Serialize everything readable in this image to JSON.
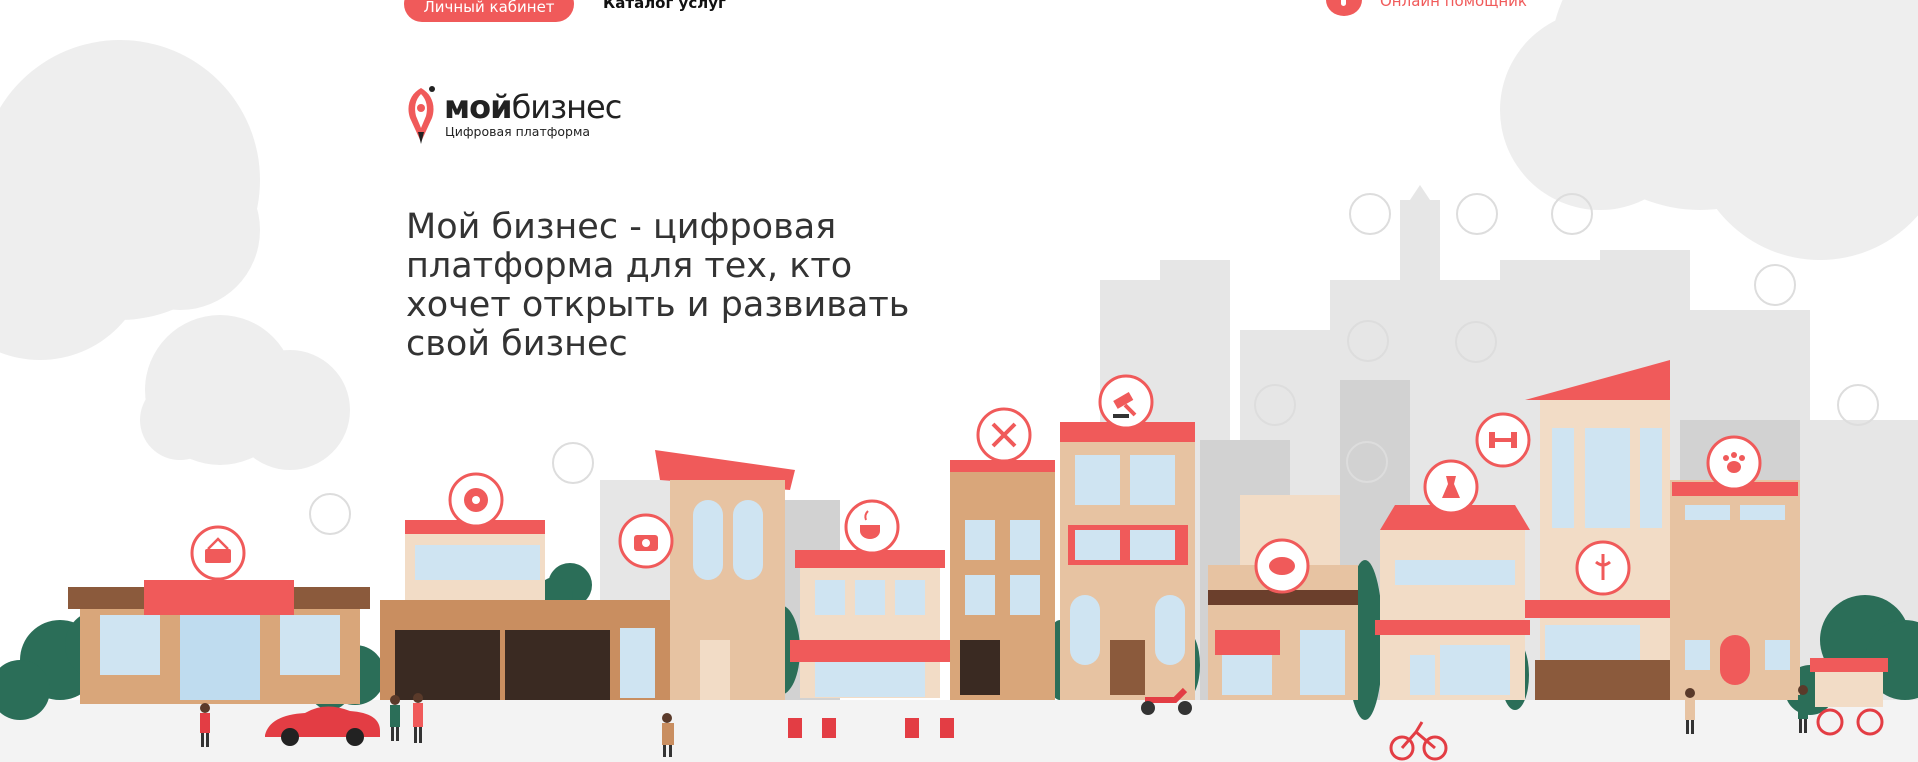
{
  "nav": {
    "cabinet_label": "Личный кабинет",
    "catalog_label": "Каталог услуг",
    "help_label": "Онлайн помощник"
  },
  "logo": {
    "name_bold": "мой",
    "name_rest": "бизнес",
    "subtitle": "Цифровая платформа"
  },
  "hero": {
    "headline": "Мой бизнес - цифровая платформа для тех, кто хочет открыть и развивать свой бизнес"
  },
  "colors": {
    "accent": "#f05a5a",
    "text": "#333333",
    "cloud": "#eeeeee",
    "skyline": "#e2e2e2",
    "tree": "#2b6e58",
    "brown": "#6b3f2c"
  },
  "illustration": {
    "icons": [
      "basket-icon",
      "film-reel-icon",
      "camera-icon",
      "coffee-cup-icon",
      "tools-icon",
      "gavel-icon",
      "bread-icon",
      "dress-icon",
      "dumbbell-icon",
      "pharmacy-icon",
      "paw-icon"
    ]
  }
}
